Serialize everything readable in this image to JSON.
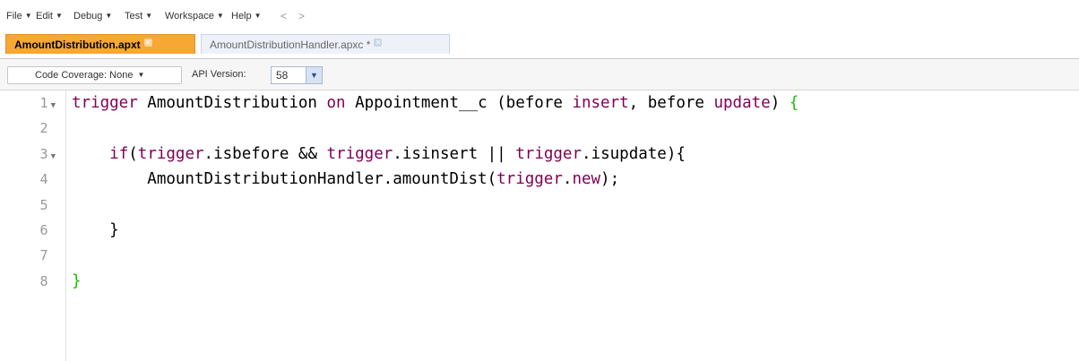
{
  "menu": {
    "items": [
      {
        "label": "File"
      },
      {
        "label": "Edit"
      },
      {
        "label": "Debug"
      },
      {
        "label": "Test"
      },
      {
        "label": "Workspace"
      },
      {
        "label": "Help"
      }
    ],
    "back": "<",
    "forward": ">"
  },
  "tabs": [
    {
      "label": "AmountDistribution.apxt",
      "active": true
    },
    {
      "label": "AmountDistributionHandler.apxc *",
      "active": false
    }
  ],
  "toolbar": {
    "code_coverage": "Code Coverage: None",
    "api_label": "API Version:",
    "api_value": "58"
  },
  "editor": {
    "line_numbers": [
      "1",
      "2",
      "3",
      "4",
      "5",
      "6",
      "7",
      "8"
    ],
    "lines": [
      {
        "tokens": [
          {
            "t": "trigger",
            "c": "kw"
          },
          {
            "t": " AmountDistribution ",
            "c": ""
          },
          {
            "t": "on",
            "c": "kw"
          },
          {
            "t": " Appointment__c (before ",
            "c": ""
          },
          {
            "t": "insert",
            "c": "kw"
          },
          {
            "t": ", before ",
            "c": ""
          },
          {
            "t": "update",
            "c": "kw"
          },
          {
            "t": ") ",
            "c": ""
          },
          {
            "t": "{",
            "c": "bracket"
          }
        ]
      },
      {
        "tokens": []
      },
      {
        "tokens": [
          {
            "t": "    ",
            "c": ""
          },
          {
            "t": "if",
            "c": "kw"
          },
          {
            "t": "(",
            "c": ""
          },
          {
            "t": "trigger",
            "c": "kw"
          },
          {
            "t": ".isbefore && ",
            "c": ""
          },
          {
            "t": "trigger",
            "c": "kw"
          },
          {
            "t": ".isinsert || ",
            "c": ""
          },
          {
            "t": "trigger",
            "c": "kw"
          },
          {
            "t": ".isupdate){",
            "c": ""
          }
        ]
      },
      {
        "tokens": [
          {
            "t": "        AmountDistributionHandler.amountDist(",
            "c": ""
          },
          {
            "t": "trigger",
            "c": "kw"
          },
          {
            "t": ".",
            "c": ""
          },
          {
            "t": "new",
            "c": "kw"
          },
          {
            "t": ");",
            "c": ""
          }
        ]
      },
      {
        "tokens": []
      },
      {
        "tokens": [
          {
            "t": "    }",
            "c": ""
          }
        ]
      },
      {
        "tokens": []
      },
      {
        "tokens": [
          {
            "t": "}",
            "c": "bracket"
          }
        ]
      }
    ],
    "foldable_lines": [
      "1",
      "3"
    ]
  },
  "colors": {
    "active_tab": "#f7a733",
    "keyword": "#7f0055",
    "bracket": "#16c000"
  }
}
